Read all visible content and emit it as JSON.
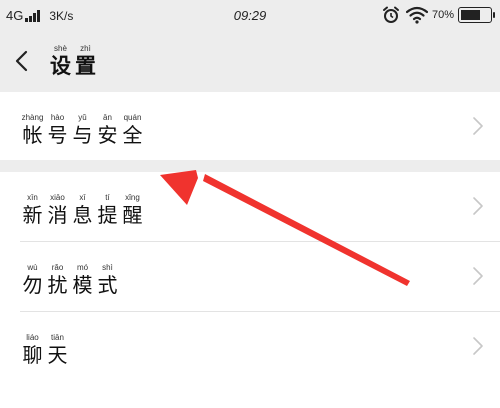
{
  "status_bar": {
    "network": "4G",
    "speed": "3K/s",
    "time": "09:29",
    "battery": "70%",
    "battery_level": 0.7
  },
  "header": {
    "title": [
      {
        "hz": "设",
        "py": "shè"
      },
      {
        "hz": "置",
        "py": "zhì"
      }
    ]
  },
  "settings": {
    "account_security": [
      {
        "hz": "帐",
        "py": "zhàng"
      },
      {
        "hz": "号",
        "py": "hào"
      },
      {
        "hz": "与",
        "py": "yǔ"
      },
      {
        "hz": "安",
        "py": "ān"
      },
      {
        "hz": "全",
        "py": "quán"
      }
    ],
    "items": [
      [
        {
          "hz": "新",
          "py": "xīn"
        },
        {
          "hz": "消",
          "py": "xiāo"
        },
        {
          "hz": "息",
          "py": "xī"
        },
        {
          "hz": "提",
          "py": "tí"
        },
        {
          "hz": "醒",
          "py": "xǐng"
        }
      ],
      [
        {
          "hz": "勿",
          "py": "wù"
        },
        {
          "hz": "扰",
          "py": "rǎo"
        },
        {
          "hz": "模",
          "py": "mó"
        },
        {
          "hz": "式",
          "py": "shì"
        }
      ],
      [
        {
          "hz": "聊",
          "py": "liáo"
        },
        {
          "hz": "天",
          "py": "tiān"
        }
      ]
    ]
  },
  "colors": {
    "page_background": "#ededed",
    "list_background": "#ffffff",
    "annotation_arrow": "#f0332e"
  },
  "icons": {
    "back": "chevron-left-icon",
    "row": "chevron-right-icon",
    "wifi": "wifi-icon",
    "alarm": "alarm-icon",
    "signal": "signal-bars-icon"
  }
}
